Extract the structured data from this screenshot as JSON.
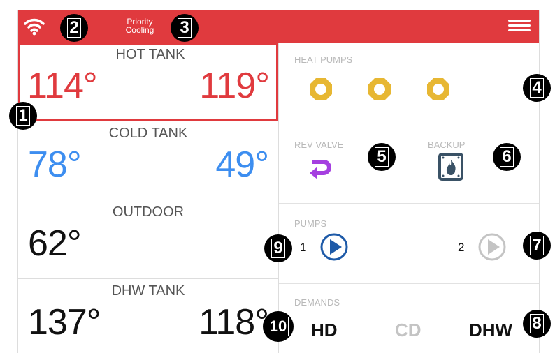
{
  "topbar": {
    "status": "Priority Cooling"
  },
  "tanks": {
    "hot": {
      "label": "HOT TANK",
      "t1": "114°",
      "t2": "119°"
    },
    "cold": {
      "label": "COLD TANK",
      "t1": "78°",
      "t2": "49°"
    },
    "outdoor": {
      "label": "OUTDOOR",
      "t1": "62°"
    },
    "dhw": {
      "label": "DHW TANK",
      "t1": "137°",
      "t2": "118°"
    }
  },
  "right": {
    "heat_pumps_label": "HEAT PUMPS",
    "rev_valve_label": "REV VALVE",
    "backup_label": "BACKUP",
    "pumps_label": "PUMPS",
    "pump1": "1",
    "pump2": "2",
    "demands_label": "DEMANDS",
    "demands": [
      "HD",
      "CD",
      "DHW"
    ]
  },
  "badges": [
    "1",
    "2",
    "3",
    "4",
    "5",
    "6",
    "7",
    "8",
    "9",
    "10"
  ],
  "colors": {
    "red": "#e03a3e",
    "blue": "#3d8ef0",
    "gold": "#e7b733",
    "purple": "#a53fe0",
    "pump_blue": "#1e5aa8",
    "inactive": "#c4c4c4"
  }
}
